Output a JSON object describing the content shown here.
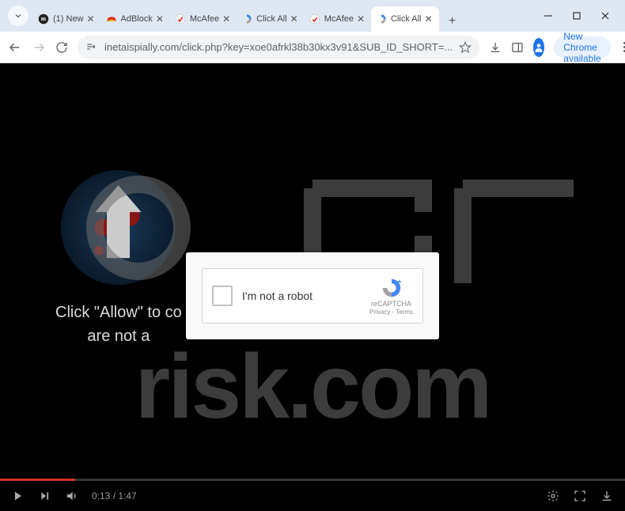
{
  "tabs": [
    {
      "label": "(1) New",
      "favicon": "86"
    },
    {
      "label": "AdBlock",
      "favicon": "ab"
    },
    {
      "label": "McAfee",
      "favicon": "mc"
    },
    {
      "label": "Click All",
      "favicon": "ca"
    },
    {
      "label": "McAfee",
      "favicon": "mc"
    },
    {
      "label": "Click All",
      "favicon": "ca",
      "active": true
    }
  ],
  "url": "inetaispially.com/click.php?key=xoe0afrkl38b30kx3v91&SUB_ID_SHORT=...",
  "chrome_badge": "New Chrome available",
  "page": {
    "allow_line1": "Click \"Allow\" to co",
    "allow_line2": "are not a",
    "watermark": "risk.com"
  },
  "captcha": {
    "label": "I'm not a robot",
    "brand": "reCAPTCHA",
    "links": "Privacy - Terms"
  },
  "video": {
    "current": "0:13",
    "total": "1:47"
  }
}
